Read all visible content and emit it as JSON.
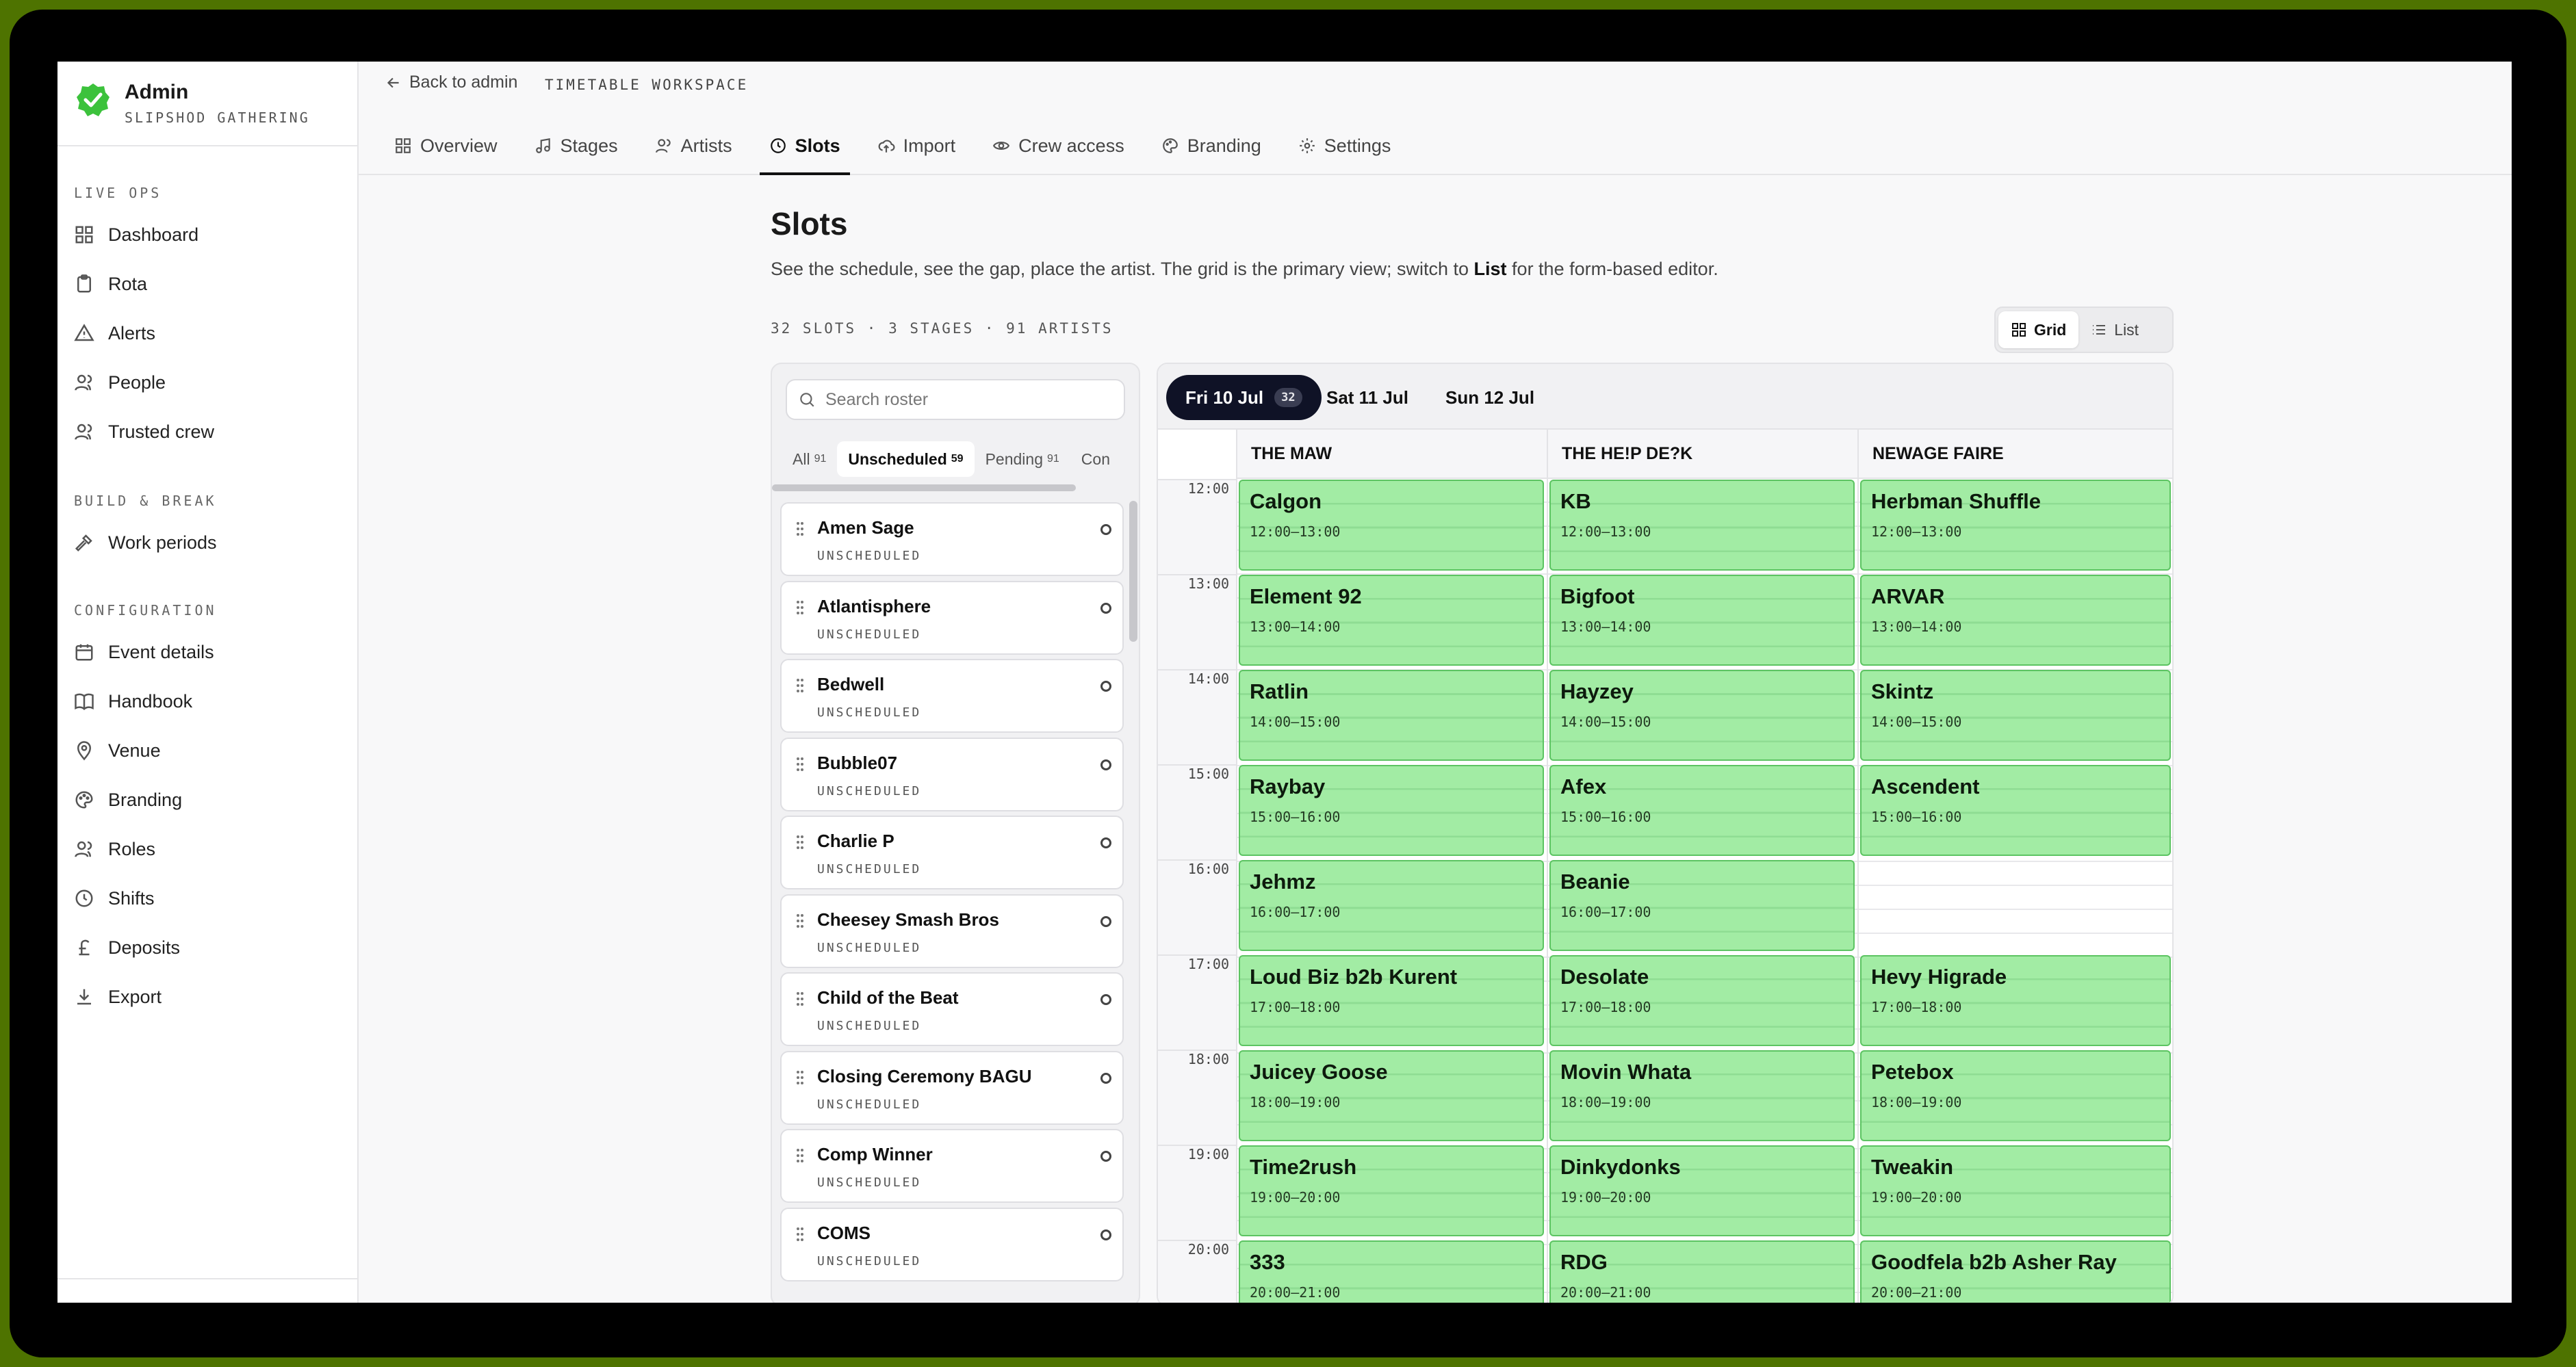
{
  "brand": {
    "title": "Admin",
    "subtitle": "SLIPSHOD GATHERING",
    "accent": "#3cc23c"
  },
  "sidebar": {
    "sections": [
      {
        "title": "LIVE OPS",
        "items": [
          {
            "label": "Dashboard",
            "icon": "grid-icon"
          },
          {
            "label": "Rota",
            "icon": "clipboard-icon"
          },
          {
            "label": "Alerts",
            "icon": "alert-triangle-icon"
          },
          {
            "label": "People",
            "icon": "users-icon"
          },
          {
            "label": "Trusted crew",
            "icon": "users-icon"
          }
        ]
      },
      {
        "title": "BUILD & BREAK",
        "items": [
          {
            "label": "Work periods",
            "icon": "hammer-icon"
          }
        ]
      },
      {
        "title": "CONFIGURATION",
        "items": [
          {
            "label": "Event details",
            "icon": "calendar-icon"
          },
          {
            "label": "Handbook",
            "icon": "book-icon"
          },
          {
            "label": "Venue",
            "icon": "map-pin-icon"
          },
          {
            "label": "Branding",
            "icon": "palette-icon"
          },
          {
            "label": "Roles",
            "icon": "users-icon"
          },
          {
            "label": "Shifts",
            "icon": "clock-icon"
          },
          {
            "label": "Deposits",
            "icon": "pound-icon"
          },
          {
            "label": "Export",
            "icon": "download-icon"
          }
        ]
      }
    ]
  },
  "header": {
    "back_label": "Back to admin",
    "workspace_label": "TIMETABLE WORKSPACE",
    "tabs": [
      {
        "label": "Overview",
        "icon": "grid-icon"
      },
      {
        "label": "Stages",
        "icon": "music-icon"
      },
      {
        "label": "Artists",
        "icon": "users-icon"
      },
      {
        "label": "Slots",
        "icon": "clock-icon",
        "active": true
      },
      {
        "label": "Import",
        "icon": "upload-cloud-icon"
      },
      {
        "label": "Crew access",
        "icon": "eye-icon"
      },
      {
        "label": "Branding",
        "icon": "palette-icon"
      },
      {
        "label": "Settings",
        "icon": "gear-icon"
      }
    ]
  },
  "page": {
    "title": "Slots",
    "description_pre": "See the schedule, see the gap, place the artist. The grid is the primary view; switch to ",
    "description_bold": "List",
    "description_post": " for the form-based editor.",
    "stats": "32 SLOTS · 3 STAGES · 91 ARTISTS",
    "view_toggle": {
      "grid": "Grid",
      "list": "List",
      "active": "Grid"
    }
  },
  "roster": {
    "search_placeholder": "Search roster",
    "filters": [
      {
        "label": "All",
        "count": "91"
      },
      {
        "label": "Unscheduled",
        "count": "59",
        "active": true
      },
      {
        "label": "Pending",
        "count": "91"
      },
      {
        "label": "Con",
        "count": ""
      }
    ],
    "artists": [
      {
        "name": "Amen Sage",
        "status": "UNSCHEDULED"
      },
      {
        "name": "Atlantisphere",
        "status": "UNSCHEDULED"
      },
      {
        "name": "Bedwell",
        "status": "UNSCHEDULED"
      },
      {
        "name": "Bubble07",
        "status": "UNSCHEDULED"
      },
      {
        "name": "Charlie P",
        "status": "UNSCHEDULED"
      },
      {
        "name": "Cheesey Smash Bros",
        "status": "UNSCHEDULED"
      },
      {
        "name": "Child of the Beat",
        "status": "UNSCHEDULED"
      },
      {
        "name": "Closing Ceremony BAGU",
        "status": "UNSCHEDULED"
      },
      {
        "name": "Comp Winner",
        "status": "UNSCHEDULED"
      },
      {
        "name": "COMS",
        "status": "UNSCHEDULED"
      }
    ]
  },
  "grid": {
    "days": [
      {
        "label": "Fri 10 Jul",
        "count": "32",
        "active": true
      },
      {
        "label": "Sat 11 Jul",
        "count": ""
      },
      {
        "label": "Sun 12 Jul",
        "count": ""
      }
    ],
    "hours": [
      "12:00",
      "13:00",
      "14:00",
      "15:00",
      "16:00",
      "17:00",
      "18:00",
      "19:00",
      "20:00"
    ],
    "stages": [
      {
        "name": "THE MAW",
        "slots": [
          {
            "artist": "Calgon",
            "time": "12:00–13:00"
          },
          {
            "artist": "Element 92",
            "time": "13:00–14:00"
          },
          {
            "artist": "Ratlin",
            "time": "14:00–15:00"
          },
          {
            "artist": "Raybay",
            "time": "15:00–16:00"
          },
          {
            "artist": "Jehmz",
            "time": "16:00–17:00"
          },
          {
            "artist": "Loud Biz b2b Kurent",
            "time": "17:00–18:00"
          },
          {
            "artist": "Juicey Goose",
            "time": "18:00–19:00"
          },
          {
            "artist": "Time2rush",
            "time": "19:00–20:00"
          },
          {
            "artist": "333",
            "time": "20:00–21:00"
          }
        ]
      },
      {
        "name": "THE HE!P DE?K",
        "slots": [
          {
            "artist": "KB",
            "time": "12:00–13:00"
          },
          {
            "artist": "Bigfoot",
            "time": "13:00–14:00"
          },
          {
            "artist": "Hayzey",
            "time": "14:00–15:00"
          },
          {
            "artist": "Afex",
            "time": "15:00–16:00"
          },
          {
            "artist": "Beanie",
            "time": "16:00–17:00"
          },
          {
            "artist": "Desolate",
            "time": "17:00–18:00"
          },
          {
            "artist": "Movin Whata",
            "time": "18:00–19:00"
          },
          {
            "artist": "Dinkydonks",
            "time": "19:00–20:00"
          },
          {
            "artist": "RDG",
            "time": "20:00–21:00"
          }
        ]
      },
      {
        "name": "NEWAGE FAIRE",
        "slots": [
          {
            "artist": "Herbman Shuffle",
            "time": "12:00–13:00"
          },
          {
            "artist": "ARVAR",
            "time": "13:00–14:00"
          },
          {
            "artist": "Skintz",
            "time": "14:00–15:00"
          },
          {
            "artist": "Ascendent",
            "time": "15:00–16:00"
          },
          null,
          {
            "artist": "Hevy Higrade",
            "time": "17:00–18:00"
          },
          {
            "artist": "Petebox",
            "time": "18:00–19:00"
          },
          {
            "artist": "Tweakin",
            "time": "19:00–20:00"
          },
          {
            "artist": "Goodfela b2b Asher Ray",
            "time": "20:00–21:00"
          }
        ]
      }
    ]
  }
}
